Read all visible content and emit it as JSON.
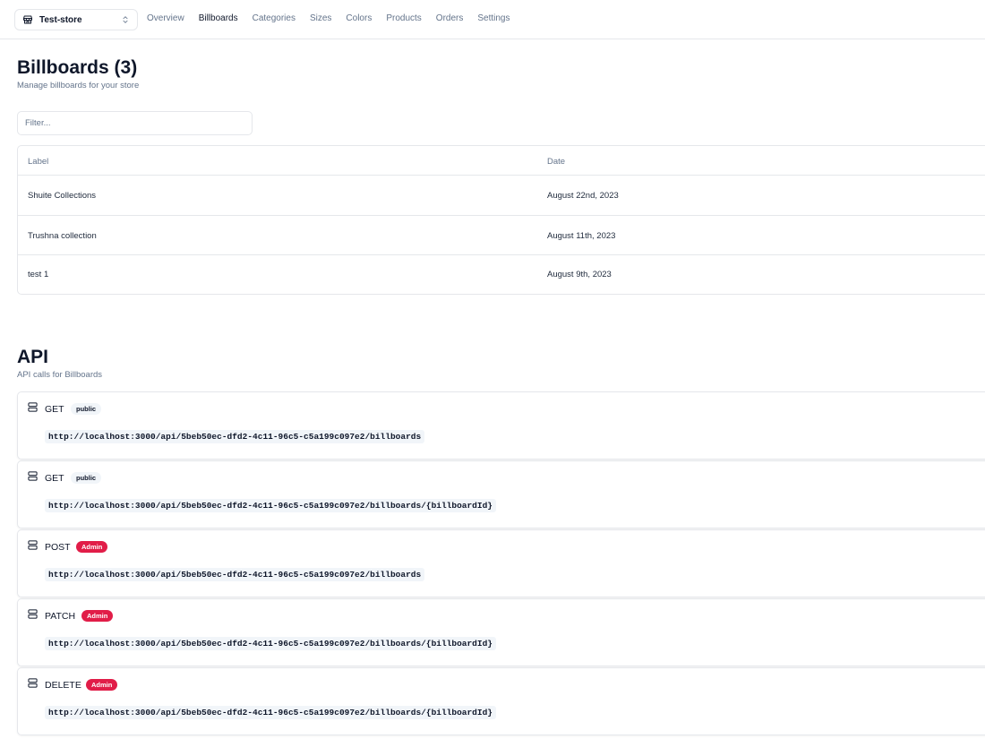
{
  "store_switcher": {
    "name": "Test-store",
    "icon": "store-icon",
    "chevron": "chevrons-up-down-icon"
  },
  "nav": {
    "items": [
      {
        "label": "Overview",
        "active": false
      },
      {
        "label": "Billboards",
        "active": true
      },
      {
        "label": "Categories",
        "active": false
      },
      {
        "label": "Sizes",
        "active": false
      },
      {
        "label": "Colors",
        "active": false
      },
      {
        "label": "Products",
        "active": false
      },
      {
        "label": "Orders",
        "active": false
      },
      {
        "label": "Settings",
        "active": false
      }
    ]
  },
  "billboards": {
    "title": "Billboards (3)",
    "subtitle": "Manage billboards for your store",
    "filter_placeholder": "Filter...",
    "table": {
      "columns": [
        "Label",
        "Date"
      ],
      "rows": [
        {
          "label": "Shuite Collections",
          "date": "August 22nd, 2023"
        },
        {
          "label": "Trushna collection",
          "date": "August 11th, 2023"
        },
        {
          "label": "test 1",
          "date": "August 9th, 2023"
        }
      ]
    }
  },
  "api": {
    "title": "API",
    "subtitle": "API calls for Billboards",
    "calls": [
      {
        "method": "GET",
        "badge": "public",
        "endpoint": "http://localhost:3000/api/5beb50ec-dfd2-4c11-96c5-c5a199c097e2/billboards"
      },
      {
        "method": "GET",
        "badge": "public",
        "endpoint": "http://localhost:3000/api/5beb50ec-dfd2-4c11-96c5-c5a199c097e2/billboards/{billboardId}"
      },
      {
        "method": "POST",
        "badge": "Admin",
        "endpoint": "http://localhost:3000/api/5beb50ec-dfd2-4c11-96c5-c5a199c097e2/billboards"
      },
      {
        "method": "PATCH",
        "badge": "Admin",
        "endpoint": "http://localhost:3000/api/5beb50ec-dfd2-4c11-96c5-c5a199c097e2/billboards/{billboardId}"
      },
      {
        "method": "DELETE",
        "badge": "Admin",
        "endpoint": "http://localhost:3000/api/5beb50ec-dfd2-4c11-96c5-c5a199c097e2/billboards/{billboardId}"
      }
    ]
  },
  "colors": {
    "text": "#0f172a",
    "muted": "#64748b",
    "border": "#e5e7eb",
    "admin_badge": "#e11d48",
    "public_badge": "#f1f5f9"
  }
}
